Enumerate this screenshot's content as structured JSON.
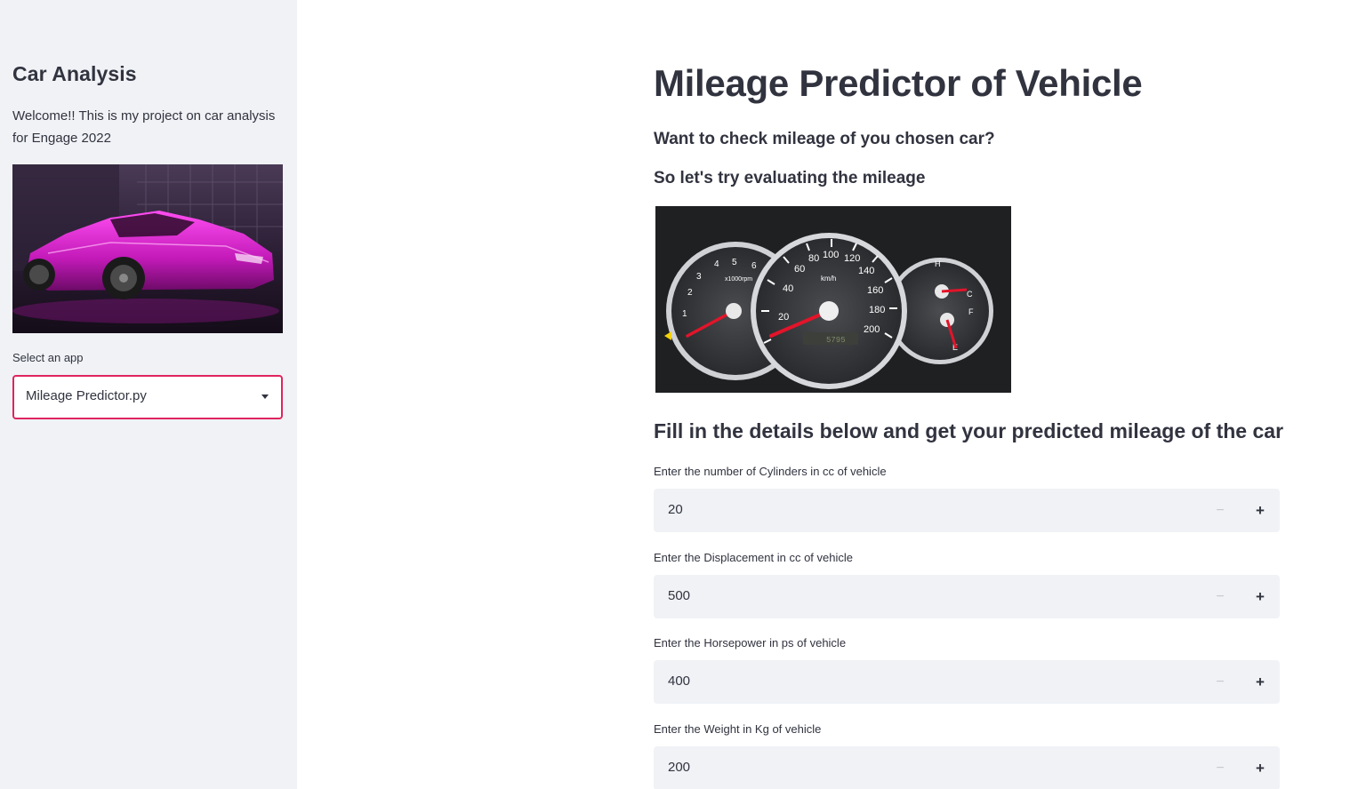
{
  "sidebar": {
    "title": "Car Analysis",
    "welcome": "Welcome!! This is my project on car analysis for Engage 2022",
    "image_icon": "sports-car-photo",
    "select_label": "Select an app",
    "select_value": "Mileage Predictor.py",
    "accent_color": "#e0245e"
  },
  "main": {
    "title": "Mileage Predictor of Vehicle",
    "subheading1": "Want to check mileage of you chosen car?",
    "subheading2": "So let's try evaluating the mileage",
    "dashboard_image_icon": "speedometer-photo",
    "gauge_center_label": "km/h",
    "gauge_left_label": "x1000rpm",
    "section_title": "Fill in the details below and get your predicted mileage of the car",
    "inputs": [
      {
        "label": "Enter the number of Cylinders in cc of vehicle",
        "value": "20"
      },
      {
        "label": "Enter the Displacement in cc of vehicle",
        "value": "500"
      },
      {
        "label": "Enter the Horsepower in ps of vehicle",
        "value": "400"
      },
      {
        "label": "Enter the Weight in Kg of vehicle",
        "value": "200"
      }
    ],
    "minus_glyph": "−",
    "plus_glyph": "+"
  }
}
